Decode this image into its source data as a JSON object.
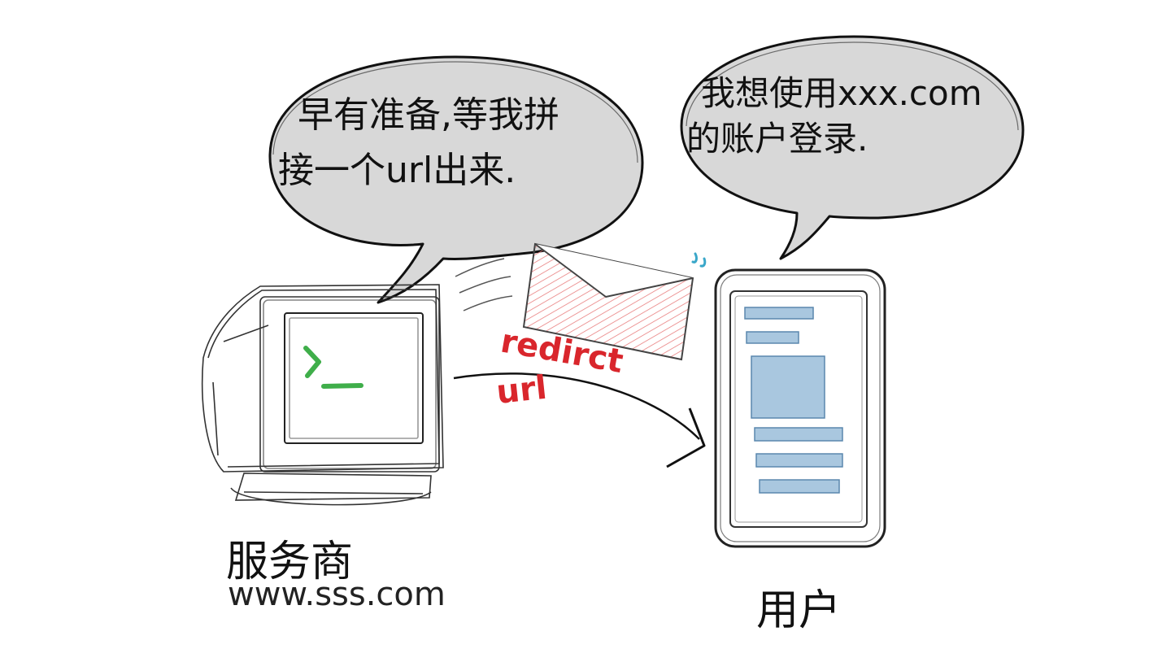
{
  "server": {
    "name": "服务商",
    "domain": "www.sss.com",
    "speech_line1": "早有准备,等我拼",
    "speech_line2": "接一个url出来."
  },
  "user": {
    "name": "用户",
    "speech_line1": "我想使用xxx.com",
    "speech_line2": "的账户登录."
  },
  "arrow": {
    "label_line1": "redirct",
    "label_line2": "url"
  },
  "colors": {
    "prompt_green": "#3fae4a",
    "label_red": "#d9262c",
    "envelope_hatch": "#e87878",
    "screen_blocks_blue": "#7fa9cc",
    "water_drop": "#3aa7c9"
  }
}
